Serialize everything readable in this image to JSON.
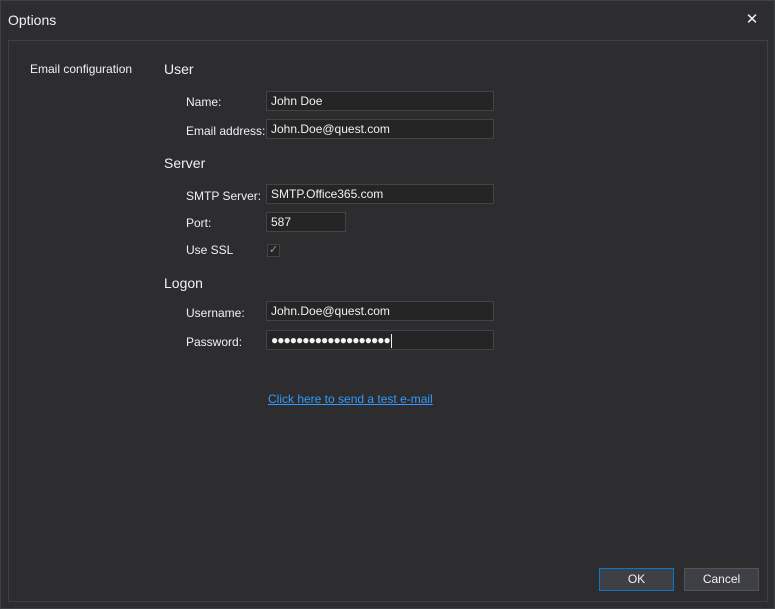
{
  "window": {
    "title": "Options"
  },
  "nav": {
    "items": [
      {
        "label": "Email configuration"
      }
    ]
  },
  "user": {
    "section_title": "User",
    "name_label": "Name:",
    "name_value": "John Doe",
    "email_label": "Email address:",
    "email_value": "John.Doe@quest.com"
  },
  "server": {
    "section_title": "Server",
    "smtp_label": "SMTP Server:",
    "smtp_value": "SMTP.Office365.com",
    "port_label": "Port:",
    "port_value": "587",
    "ssl_label": "Use SSL",
    "ssl_checked": true,
    "ssl_checkmark": "✓"
  },
  "logon": {
    "section_title": "Logon",
    "username_label": "Username:",
    "username_value": "John.Doe@quest.com",
    "password_label": "Password:",
    "password_mask": "●●●●●●●●●●●●●●●●●●●"
  },
  "test_link": "Click here to send a test e-mail",
  "buttons": {
    "ok": "OK",
    "cancel": "Cancel"
  },
  "icons": {
    "close": "close-icon",
    "checkmark": "check-icon"
  },
  "colors": {
    "background": "#2d2d30",
    "accent": "#007acc",
    "link": "#3399ff"
  }
}
